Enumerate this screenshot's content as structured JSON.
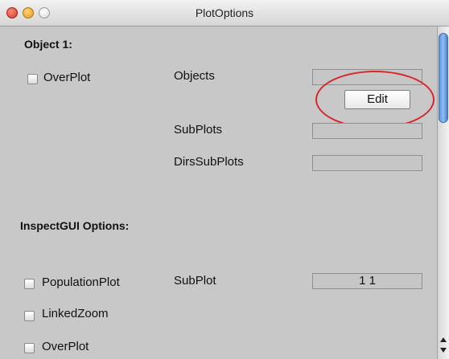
{
  "window": {
    "title": "PlotOptions"
  },
  "object_section": {
    "heading": "Object 1:",
    "overplot_label": "OverPlot",
    "objects_label": "Objects",
    "objects_value": "",
    "edit_label": "Edit",
    "subplots_label": "SubPlots",
    "subplots_value": "",
    "dirs_subplots_label": "DirsSubPlots",
    "dirs_subplots_value": ""
  },
  "inspect_section": {
    "heading": "InspectGUI Options:",
    "population_plot_label": "PopulationPlot",
    "subplot_label": "SubPlot",
    "subplot_value": "1 1",
    "linked_zoom_label": "LinkedZoom",
    "overplot_label": "OverPlot"
  },
  "colors": {
    "annotation": "#d9262b",
    "scroll_thumb": "#6aa0e8"
  }
}
